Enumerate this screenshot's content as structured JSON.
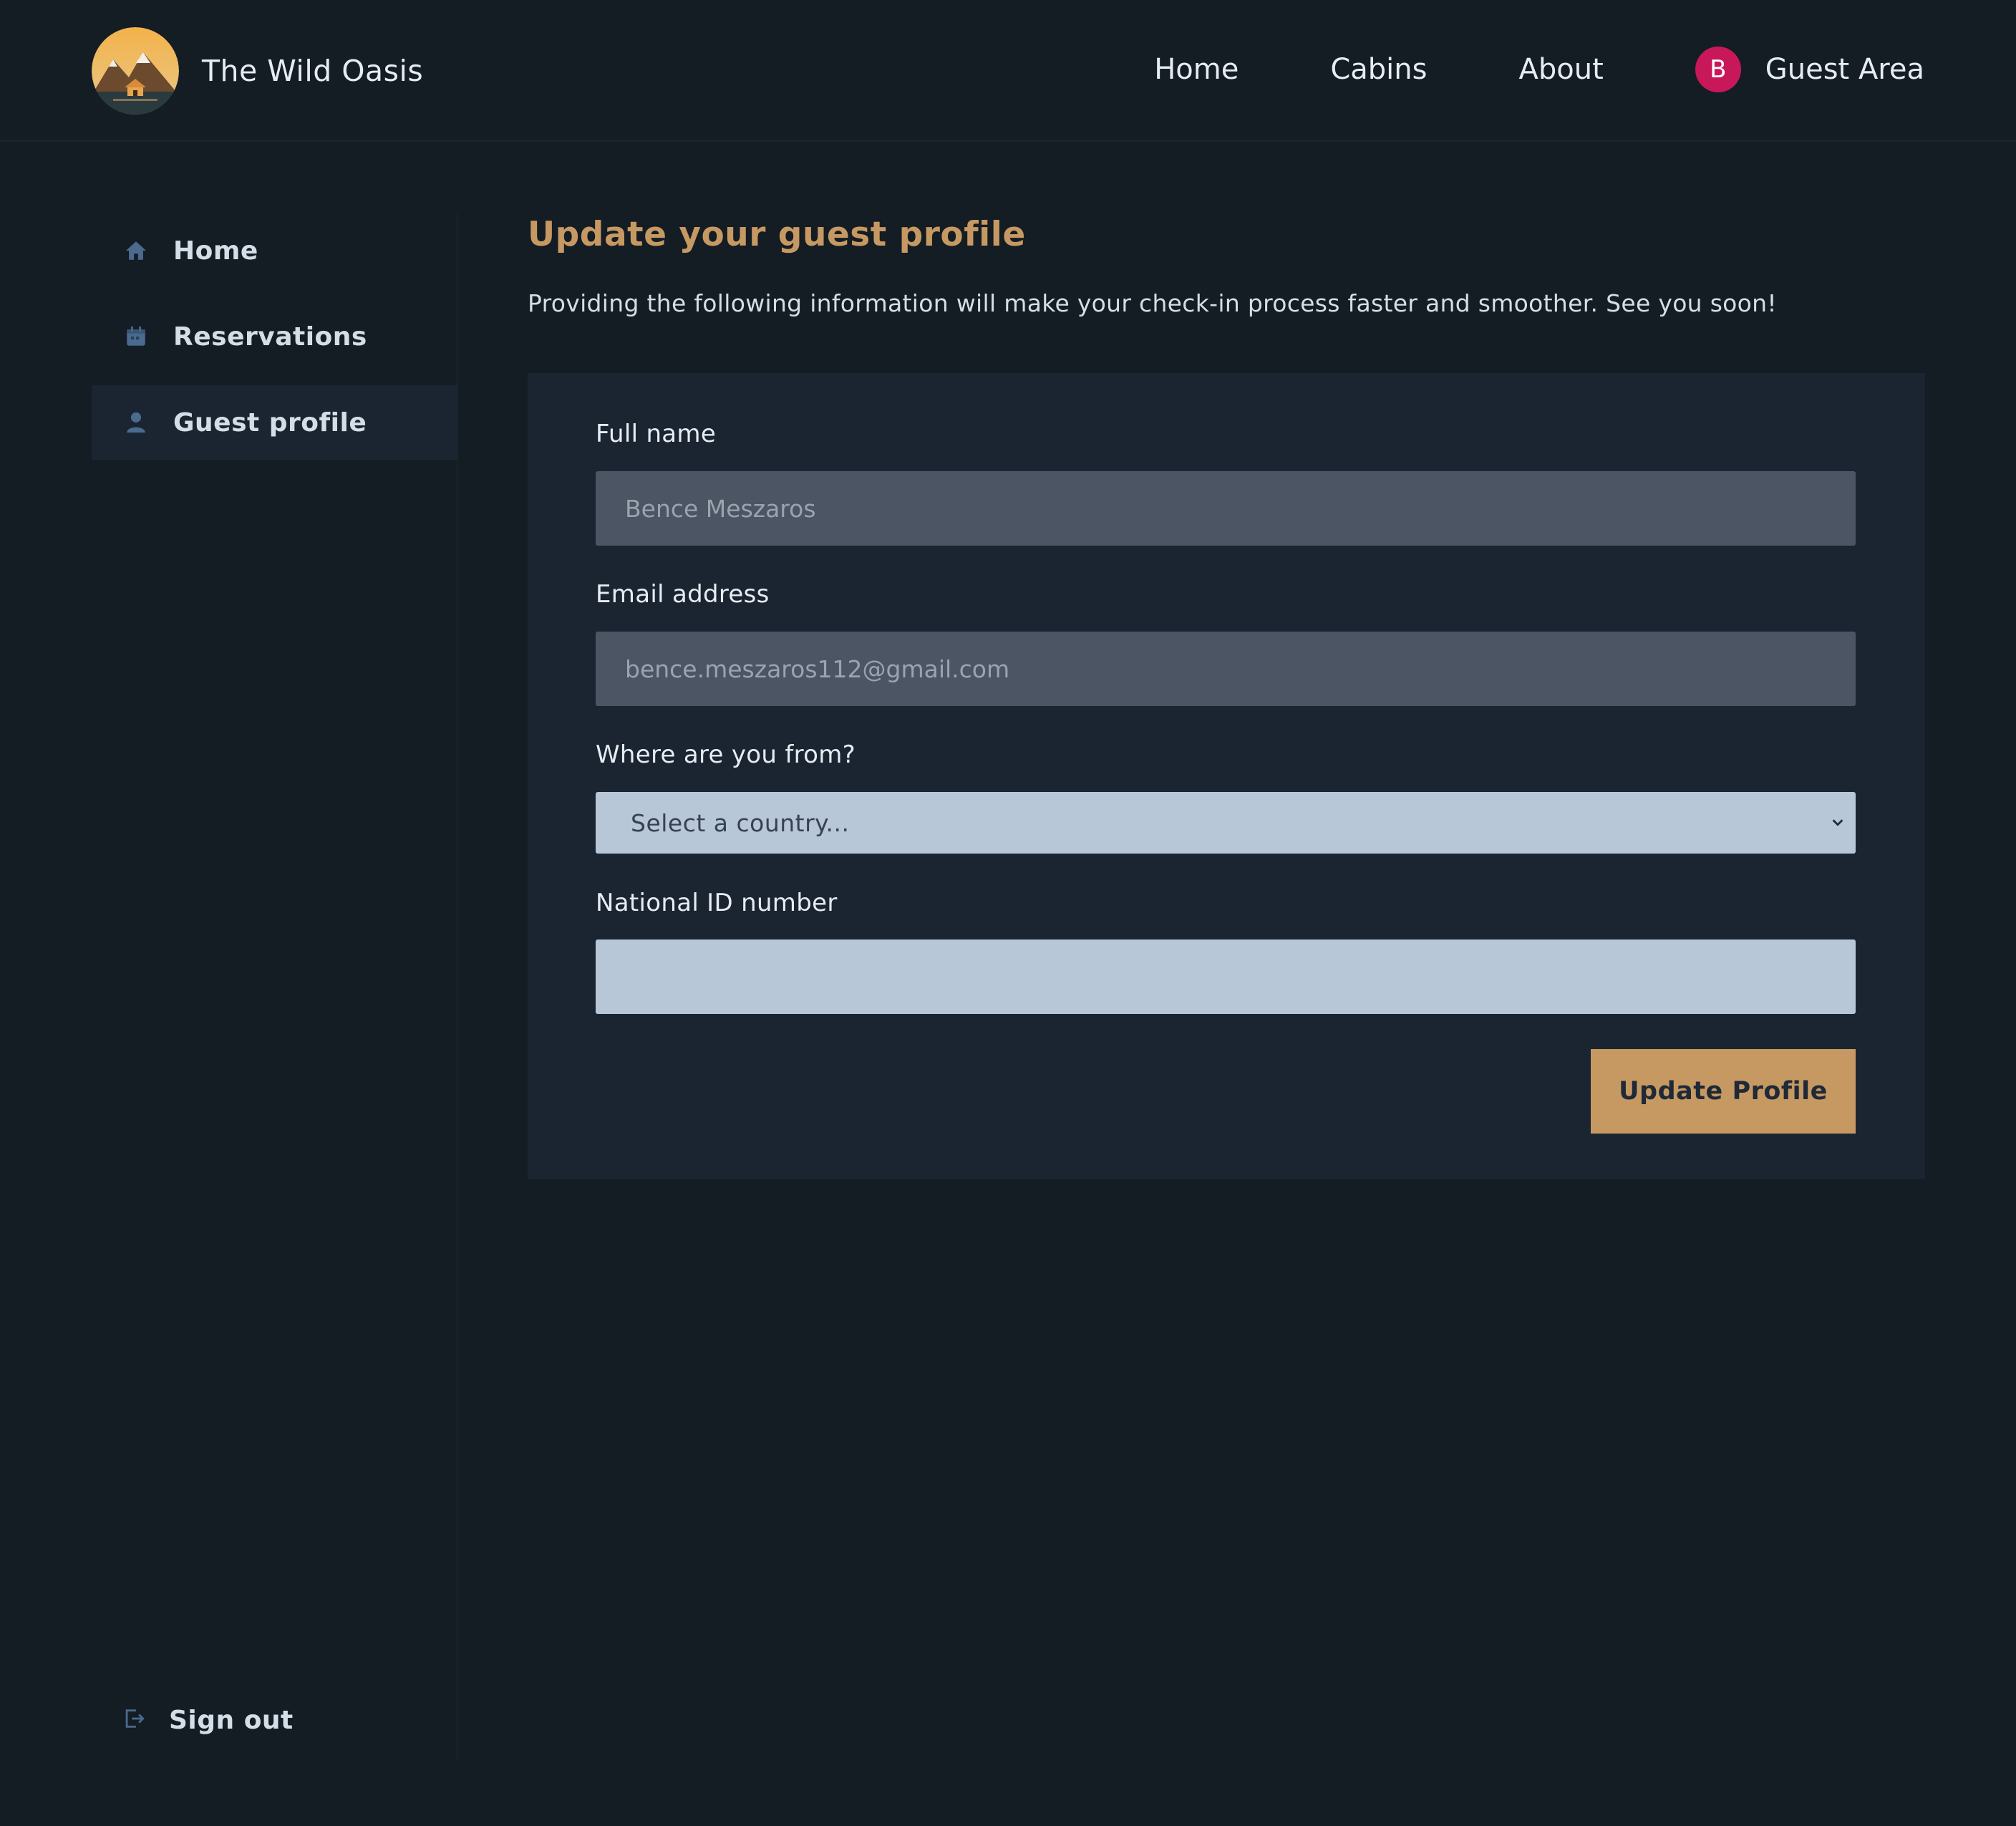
{
  "header": {
    "brand": "The Wild Oasis",
    "nav": [
      "Home",
      "Cabins",
      "About"
    ],
    "avatar_initial": "B",
    "guest_area_label": "Guest Area"
  },
  "sidebar": {
    "items": [
      {
        "label": "Home",
        "icon": "home-icon"
      },
      {
        "label": "Reservations",
        "icon": "calendar-icon"
      },
      {
        "label": "Guest profile",
        "icon": "user-icon",
        "active": true
      }
    ],
    "signout_label": "Sign out"
  },
  "main": {
    "title": "Update your guest profile",
    "subtitle": "Providing the following information will make your check-in process faster and smoother. See you soon!",
    "form": {
      "full_name_label": "Full name",
      "full_name_value": "Bence Meszaros",
      "email_label": "Email address",
      "email_value": "bence.meszaros112@gmail.com",
      "country_label": "Where are you from?",
      "country_placeholder": "Select a country...",
      "national_id_label": "National ID number",
      "national_id_value": "",
      "submit_label": "Update Profile"
    }
  },
  "colors": {
    "background": "#141c24",
    "accent": "#c69963",
    "avatar": "#c8185a",
    "panel": "#1b2532"
  }
}
